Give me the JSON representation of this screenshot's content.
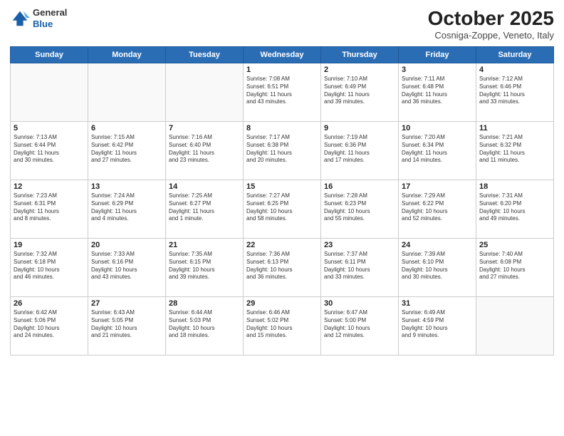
{
  "header": {
    "logo_line1": "General",
    "logo_line2": "Blue",
    "month": "October 2025",
    "location": "Cosniga-Zoppe, Veneto, Italy"
  },
  "days_of_week": [
    "Sunday",
    "Monday",
    "Tuesday",
    "Wednesday",
    "Thursday",
    "Friday",
    "Saturday"
  ],
  "weeks": [
    [
      {
        "day": "",
        "info": ""
      },
      {
        "day": "",
        "info": ""
      },
      {
        "day": "",
        "info": ""
      },
      {
        "day": "1",
        "info": "Sunrise: 7:08 AM\nSunset: 6:51 PM\nDaylight: 11 hours\nand 43 minutes."
      },
      {
        "day": "2",
        "info": "Sunrise: 7:10 AM\nSunset: 6:49 PM\nDaylight: 11 hours\nand 39 minutes."
      },
      {
        "day": "3",
        "info": "Sunrise: 7:11 AM\nSunset: 6:48 PM\nDaylight: 11 hours\nand 36 minutes."
      },
      {
        "day": "4",
        "info": "Sunrise: 7:12 AM\nSunset: 6:46 PM\nDaylight: 11 hours\nand 33 minutes."
      }
    ],
    [
      {
        "day": "5",
        "info": "Sunrise: 7:13 AM\nSunset: 6:44 PM\nDaylight: 11 hours\nand 30 minutes."
      },
      {
        "day": "6",
        "info": "Sunrise: 7:15 AM\nSunset: 6:42 PM\nDaylight: 11 hours\nand 27 minutes."
      },
      {
        "day": "7",
        "info": "Sunrise: 7:16 AM\nSunset: 6:40 PM\nDaylight: 11 hours\nand 23 minutes."
      },
      {
        "day": "8",
        "info": "Sunrise: 7:17 AM\nSunset: 6:38 PM\nDaylight: 11 hours\nand 20 minutes."
      },
      {
        "day": "9",
        "info": "Sunrise: 7:19 AM\nSunset: 6:36 PM\nDaylight: 11 hours\nand 17 minutes."
      },
      {
        "day": "10",
        "info": "Sunrise: 7:20 AM\nSunset: 6:34 PM\nDaylight: 11 hours\nand 14 minutes."
      },
      {
        "day": "11",
        "info": "Sunrise: 7:21 AM\nSunset: 6:32 PM\nDaylight: 11 hours\nand 11 minutes."
      }
    ],
    [
      {
        "day": "12",
        "info": "Sunrise: 7:23 AM\nSunset: 6:31 PM\nDaylight: 11 hours\nand 8 minutes."
      },
      {
        "day": "13",
        "info": "Sunrise: 7:24 AM\nSunset: 6:29 PM\nDaylight: 11 hours\nand 4 minutes."
      },
      {
        "day": "14",
        "info": "Sunrise: 7:25 AM\nSunset: 6:27 PM\nDaylight: 11 hours\nand 1 minute."
      },
      {
        "day": "15",
        "info": "Sunrise: 7:27 AM\nSunset: 6:25 PM\nDaylight: 10 hours\nand 58 minutes."
      },
      {
        "day": "16",
        "info": "Sunrise: 7:28 AM\nSunset: 6:23 PM\nDaylight: 10 hours\nand 55 minutes."
      },
      {
        "day": "17",
        "info": "Sunrise: 7:29 AM\nSunset: 6:22 PM\nDaylight: 10 hours\nand 52 minutes."
      },
      {
        "day": "18",
        "info": "Sunrise: 7:31 AM\nSunset: 6:20 PM\nDaylight: 10 hours\nand 49 minutes."
      }
    ],
    [
      {
        "day": "19",
        "info": "Sunrise: 7:32 AM\nSunset: 6:18 PM\nDaylight: 10 hours\nand 46 minutes."
      },
      {
        "day": "20",
        "info": "Sunrise: 7:33 AM\nSunset: 6:16 PM\nDaylight: 10 hours\nand 43 minutes."
      },
      {
        "day": "21",
        "info": "Sunrise: 7:35 AM\nSunset: 6:15 PM\nDaylight: 10 hours\nand 39 minutes."
      },
      {
        "day": "22",
        "info": "Sunrise: 7:36 AM\nSunset: 6:13 PM\nDaylight: 10 hours\nand 36 minutes."
      },
      {
        "day": "23",
        "info": "Sunrise: 7:37 AM\nSunset: 6:11 PM\nDaylight: 10 hours\nand 33 minutes."
      },
      {
        "day": "24",
        "info": "Sunrise: 7:39 AM\nSunset: 6:10 PM\nDaylight: 10 hours\nand 30 minutes."
      },
      {
        "day": "25",
        "info": "Sunrise: 7:40 AM\nSunset: 6:08 PM\nDaylight: 10 hours\nand 27 minutes."
      }
    ],
    [
      {
        "day": "26",
        "info": "Sunrise: 6:42 AM\nSunset: 5:06 PM\nDaylight: 10 hours\nand 24 minutes."
      },
      {
        "day": "27",
        "info": "Sunrise: 6:43 AM\nSunset: 5:05 PM\nDaylight: 10 hours\nand 21 minutes."
      },
      {
        "day": "28",
        "info": "Sunrise: 6:44 AM\nSunset: 5:03 PM\nDaylight: 10 hours\nand 18 minutes."
      },
      {
        "day": "29",
        "info": "Sunrise: 6:46 AM\nSunset: 5:02 PM\nDaylight: 10 hours\nand 15 minutes."
      },
      {
        "day": "30",
        "info": "Sunrise: 6:47 AM\nSunset: 5:00 PM\nDaylight: 10 hours\nand 12 minutes."
      },
      {
        "day": "31",
        "info": "Sunrise: 6:49 AM\nSunset: 4:59 PM\nDaylight: 10 hours\nand 9 minutes."
      },
      {
        "day": "",
        "info": ""
      }
    ]
  ]
}
